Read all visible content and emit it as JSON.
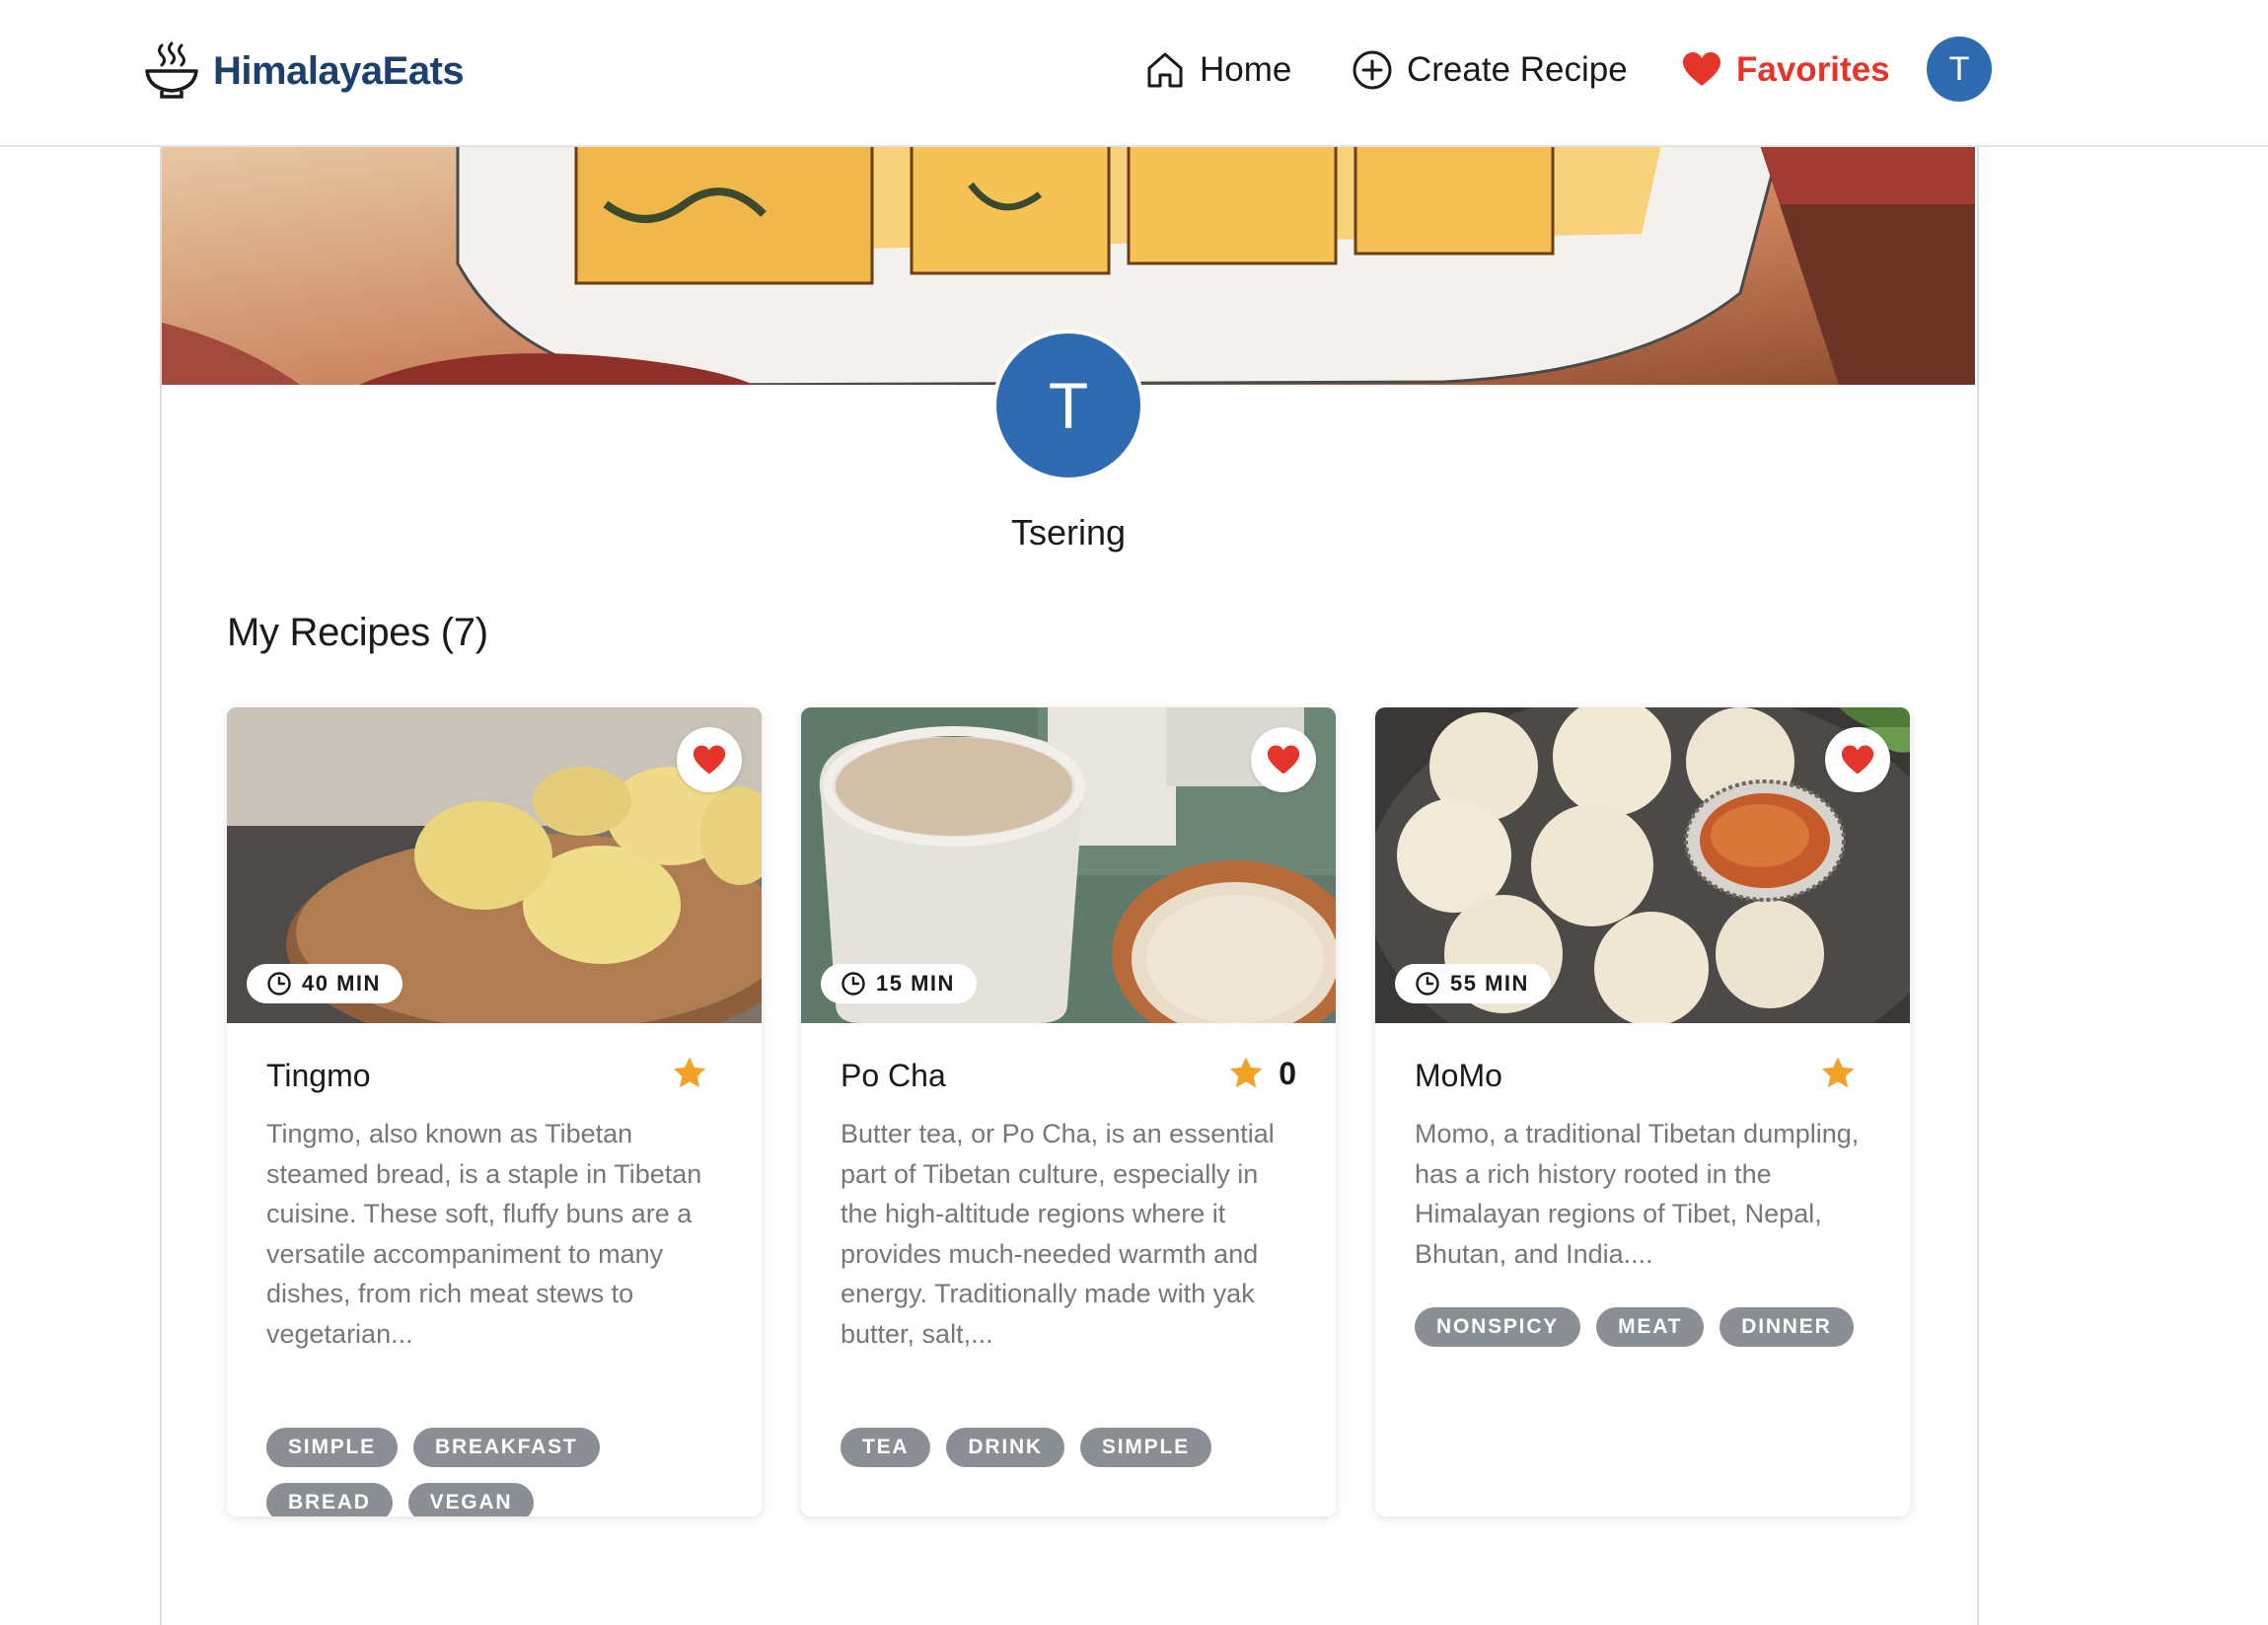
{
  "brand": {
    "name": "HimalayaEats",
    "icon": "steaming-bowl-icon"
  },
  "nav": {
    "home": {
      "label": "Home",
      "icon": "home-icon"
    },
    "create": {
      "label": "Create Recipe",
      "icon": "plus-circle-icon"
    },
    "favorites": {
      "label": "Favorites",
      "icon": "heart-icon"
    },
    "avatar_initial": "T"
  },
  "profile": {
    "initial": "T",
    "name": "Tsering"
  },
  "section": {
    "title": "My Recipes (7)"
  },
  "colors": {
    "brand": "#1c3f6e",
    "accent": "#e53429",
    "avatar": "#2f6bb0",
    "tag": "#8a8f96",
    "star": "#f2a228"
  },
  "recipes": [
    {
      "title": "Tingmo",
      "time": "40 MIN",
      "rating": "",
      "description": "Tingmo, also known as Tibetan steamed bread, is a staple in Tibetan cuisine. These soft, fluffy buns are a versatile accompaniment to many dishes, from rich meat stews to vegetarian...",
      "tags": [
        "SIMPLE",
        "BREAKFAST",
        "BREAD",
        "VEGAN"
      ]
    },
    {
      "title": "Po Cha",
      "time": "15 MIN",
      "rating": "0",
      "description": "Butter tea, or Po Cha, is an essential part of Tibetan culture, especially in the high-altitude regions where it provides much-needed warmth and energy. Traditionally made with yak butter, salt,...",
      "tags": [
        "TEA",
        "DRINK",
        "SIMPLE"
      ]
    },
    {
      "title": "MoMo",
      "time": "55 MIN",
      "rating": "",
      "description": "Momo, a traditional Tibetan dumpling, has a rich history rooted in the Himalayan regions of Tibet, Nepal, Bhutan, and India....",
      "tags": [
        "NONSPICY",
        "MEAT",
        "DINNER"
      ]
    }
  ]
}
